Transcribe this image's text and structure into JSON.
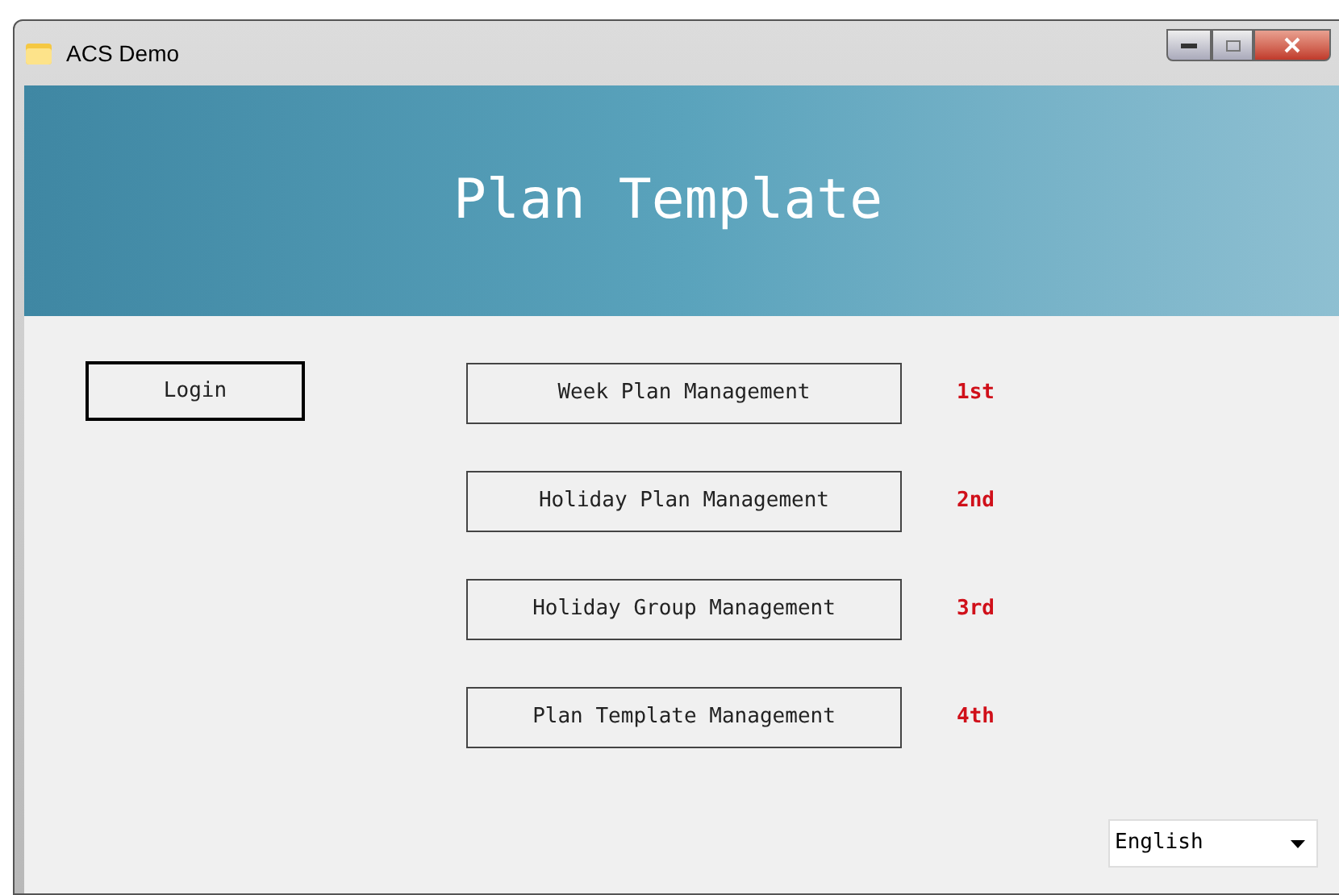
{
  "window": {
    "title": "ACS Demo"
  },
  "header": {
    "title": "Plan Template"
  },
  "login": {
    "label": "Login",
    "default": true
  },
  "steps": [
    {
      "label": "Week Plan Management",
      "order": "1st"
    },
    {
      "label": "Holiday Plan Management",
      "order": "2nd"
    },
    {
      "label": "Holiday Group Management",
      "order": "3rd"
    },
    {
      "label": "Plan Template Management",
      "order": "4th"
    }
  ],
  "language": {
    "value": "English"
  }
}
